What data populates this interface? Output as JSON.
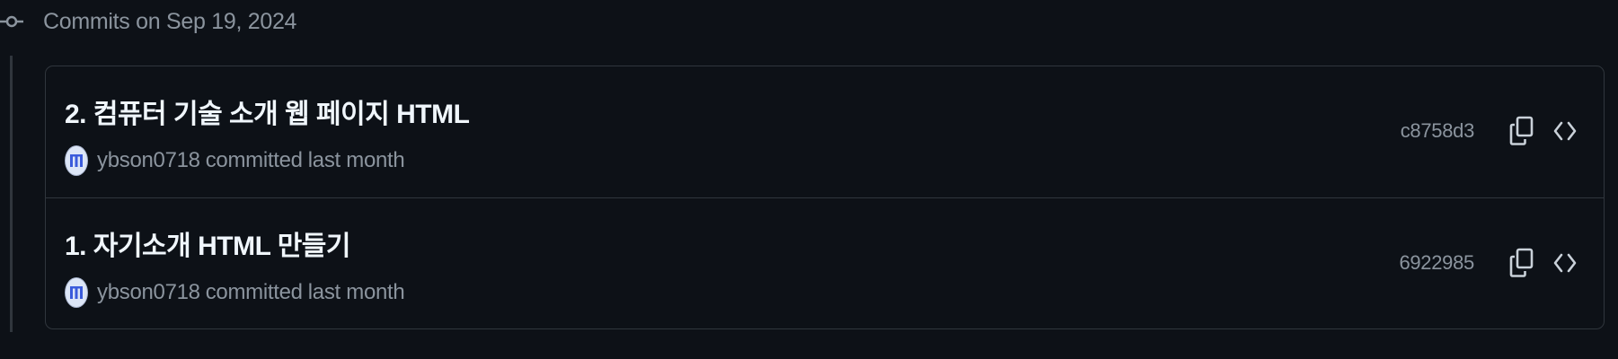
{
  "timeline": {
    "date_label": "Commits on Sep 19, 2024"
  },
  "commits": [
    {
      "title": "2. 컴퓨터 기술 소개 웹 페이지 HTML",
      "author": "ybson0718",
      "verb": "committed",
      "time": "last month",
      "sha": "c8758d3",
      "icons": [
        "copy-icon",
        "code-icon"
      ]
    },
    {
      "title": "1. 자기소개 HTML 만들기",
      "author": "ybson0718",
      "verb": "committed",
      "time": "last month",
      "sha": "6922985",
      "icons": [
        "copy-icon",
        "code-icon"
      ]
    }
  ],
  "colors": {
    "background": "#0d1117",
    "border": "#30363d",
    "muted_text": "#8b949e",
    "title_text": "#f0f6fc"
  }
}
